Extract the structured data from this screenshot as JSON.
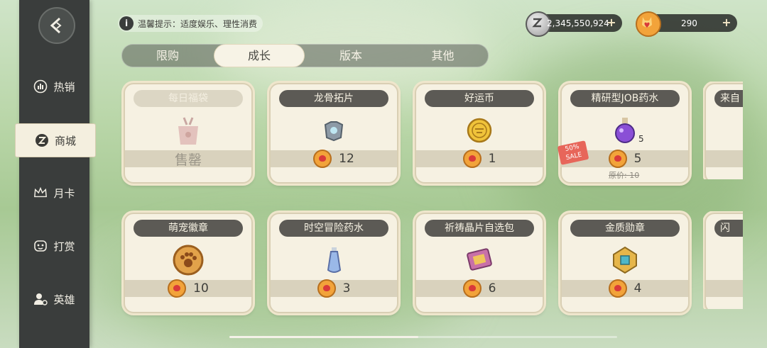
{
  "notice": {
    "icon": "i",
    "text": "温馨提示：适度娱乐、理性消费"
  },
  "currencies": [
    {
      "value": "2,345,550,924",
      "icon": "zeny-coin-icon",
      "plus": "+"
    },
    {
      "value": "290",
      "icon": "big-cat-coin-icon",
      "plus": "+"
    }
  ],
  "sidebar": {
    "items": [
      {
        "label": "热销",
        "icon": "bar-chart-icon"
      },
      {
        "label": "商城",
        "icon": "zeny-icon",
        "active": true
      },
      {
        "label": "月卡",
        "icon": "crown-icon"
      },
      {
        "label": "打赏",
        "icon": "gift-face-icon"
      },
      {
        "label": "英雄",
        "icon": "user-hero-icon"
      }
    ]
  },
  "tabs": [
    {
      "label": "限购"
    },
    {
      "label": "成长",
      "active": true
    },
    {
      "label": "版本"
    },
    {
      "label": "其他"
    }
  ],
  "cards": [
    {
      "title": "每日福袋",
      "price": "售罄",
      "sold_out": true,
      "icon": "lucky-bag-icon"
    },
    {
      "title": "龙骨拓片",
      "price": "12",
      "icon": "dragon-bone-icon"
    },
    {
      "title": "好运币",
      "price": "1",
      "icon": "lucky-coin-icon"
    },
    {
      "title": "精研型JOB药水",
      "price": "5",
      "icon": "potion-icon",
      "stack": "5",
      "sale": "50%\nSALE",
      "original": "原价: 10"
    },
    {
      "title": "萌宠徽章",
      "price": "10",
      "icon": "paw-badge-icon"
    },
    {
      "title": "时空冒险药水",
      "price": "3",
      "icon": "vial-icon"
    },
    {
      "title": "祈祷晶片自选包",
      "price": "6",
      "icon": "card-pack-icon"
    },
    {
      "title": "金质勋章",
      "price": "4",
      "icon": "gold-medal-icon"
    }
  ],
  "partial_cards": [
    {
      "title": "来自"
    },
    {
      "title": "闪"
    }
  ]
}
